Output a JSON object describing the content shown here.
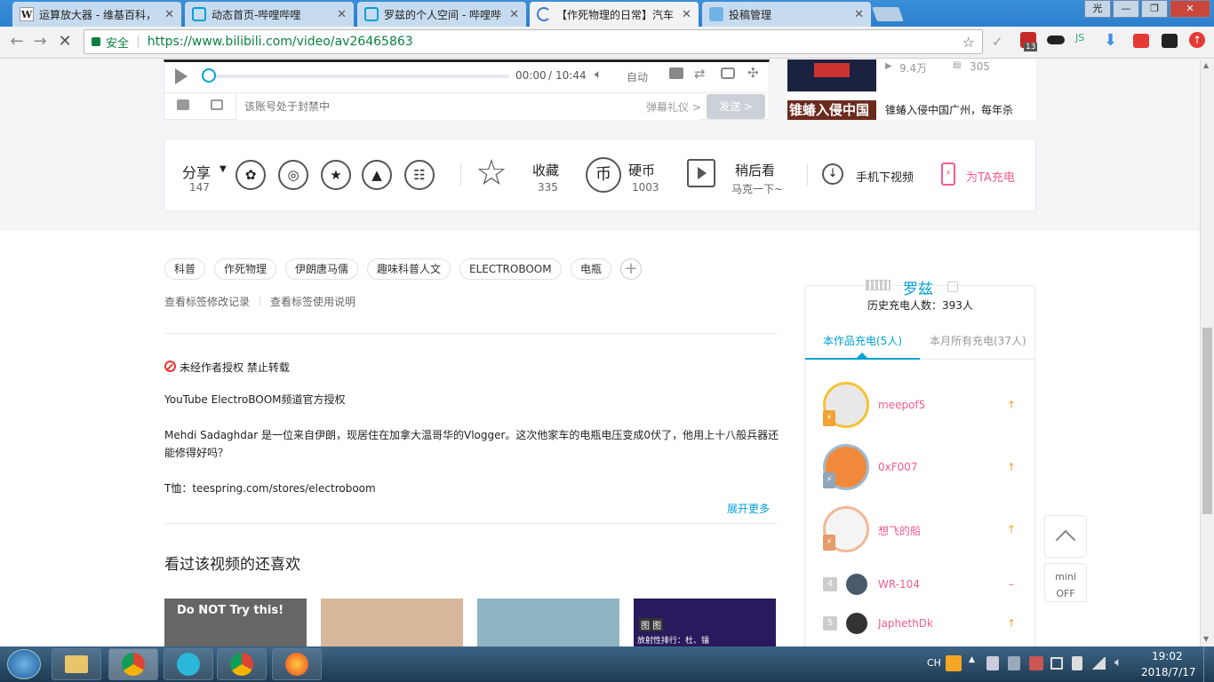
{
  "tabs": [
    {
      "label": "运算放大器 - 维基百科，",
      "icon": "W"
    },
    {
      "label": "动态首页-哔哩哔哩",
      "icon": "tv"
    },
    {
      "label": "罗兹的个人空间 - 哔哩哔",
      "icon": "tv"
    },
    {
      "label": "【作死物理的日常】汽车",
      "icon": "load",
      "active": true
    },
    {
      "label": "投稿管理",
      "icon": "cat"
    }
  ],
  "window_buttons": {
    "profile": "光",
    "min": "—",
    "max": "❐",
    "close": "✕"
  },
  "address": {
    "secure_label": "安全",
    "url": "https://www.bilibili.com/video/av26465863",
    "extension_badge": "13"
  },
  "player": {
    "time_current": "00:00",
    "time_sep": "/",
    "time_total": "10:44",
    "auto_label": "自动",
    "danmaku_placeholder": "该账号处于封禁中",
    "etiquette_label": "弹幕礼仪 >",
    "send_label": "发送 >"
  },
  "side_video": {
    "views": "9.4万",
    "danmaku": "305",
    "thumb_text": "锥蝽入侵中国",
    "title": "锥蝽入侵中国广州，每年杀"
  },
  "actions": {
    "share_label": "分享",
    "share_count": "147",
    "fav_label": "收藏",
    "fav_count": "335",
    "coin_label": "硬币",
    "coin_count": "1003",
    "later_label": "稍后看",
    "later_sub": "马克一下~",
    "download_label": "手机下视频",
    "charge_label": "为TA充电"
  },
  "tags": [
    "科普",
    "作死物理",
    "伊朗唐马儒",
    "趣味科普人文",
    "ELECTROBOOM",
    "电瓶"
  ],
  "tag_links": {
    "history": "查看标签修改记录",
    "usage": "查看标签使用说明"
  },
  "description": {
    "notice": "未经作者授权 禁止转载",
    "line1": "YouTube ElectroBOOM频道官方授权",
    "line2": "Mehdi Sadaghdar 是一位来自伊朗，现居住在加拿大温哥华的Vlogger。这次他家车的电瓶电压变成0伏了，他用上十八般兵器还",
    "line3": "能修得好吗？",
    "line4": "T恤：teespring.com/stores/electroboom",
    "expand": "展开更多"
  },
  "recommend": {
    "title": "看过该视频的还喜欢",
    "thumb1_text": "Do NOT Try this!",
    "thumb4_text1": "图 图",
    "thumb4_text2": "放射性排行：杜、镭"
  },
  "charge": {
    "name": "罗兹",
    "total_label": "历史充电人数：393人",
    "tab_work": "本作品充电(5人)",
    "tab_month": "本月所有充电(37人)",
    "list": [
      {
        "name": "meepof5",
        "trend": "↑"
      },
      {
        "name": "0xF007",
        "trend": "↑"
      },
      {
        "name": "想飞的船",
        "trend": "↑"
      },
      {
        "rank": "4",
        "name": "WR-104",
        "trend": "–"
      },
      {
        "rank": "5",
        "name": "JaphethDk",
        "trend": "↑"
      }
    ]
  },
  "mini": {
    "label1": "mini",
    "label2": "OFF"
  },
  "taskbar": {
    "lang": "CH",
    "time": "19:02",
    "date": "2018/7/17"
  },
  "colors": {
    "accent": "#00a1d6",
    "pink": "#f25d8e",
    "orange": "#f3a034"
  }
}
